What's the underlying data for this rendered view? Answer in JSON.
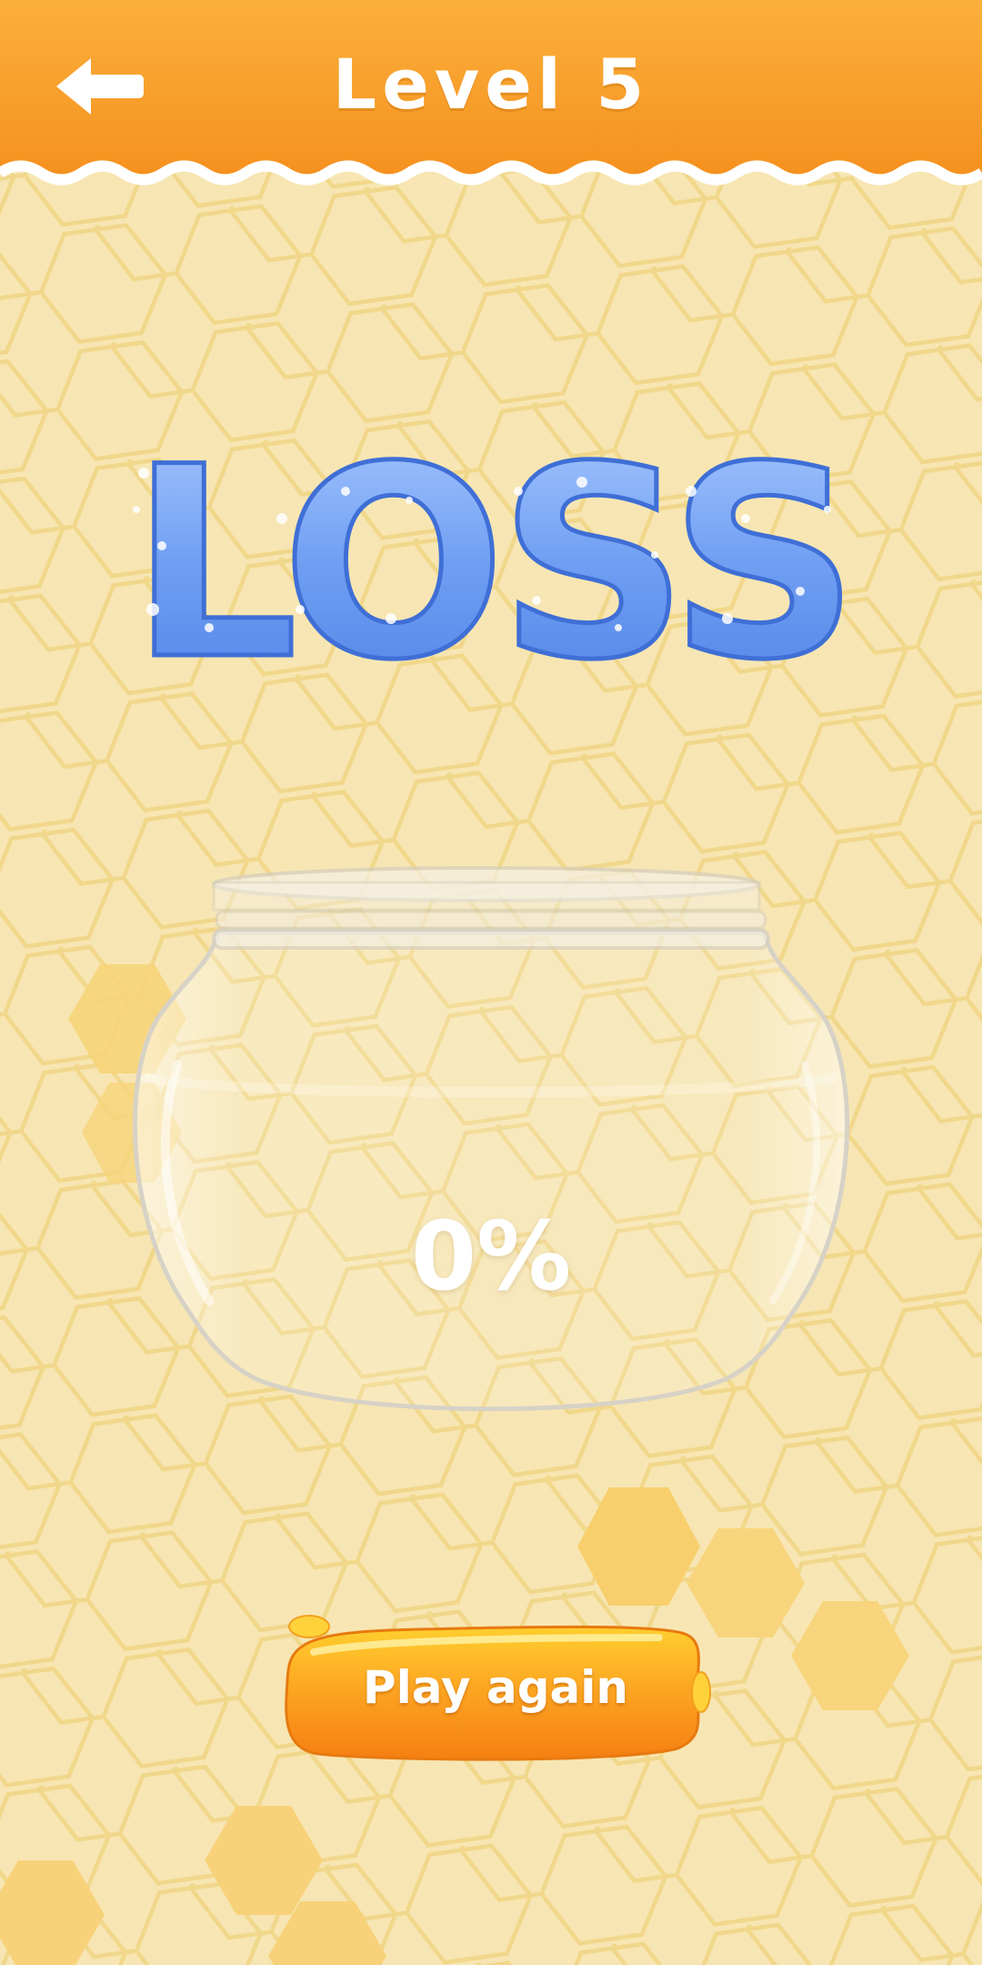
{
  "header": {
    "back_icon": "arrow-left-icon",
    "level_label": "Level 5"
  },
  "result": {
    "title": "LOSS",
    "fill_percent_label": "0%",
    "fill_fraction": 0
  },
  "actions": {
    "play_again_label": "Play again"
  },
  "colors": {
    "header_orange": "#f7a12c",
    "background": "#f7e6b3",
    "honeycomb_line": "#f2d88e",
    "loss_blue": "#6f9ef2",
    "button_orange": "#fb9a1d"
  }
}
